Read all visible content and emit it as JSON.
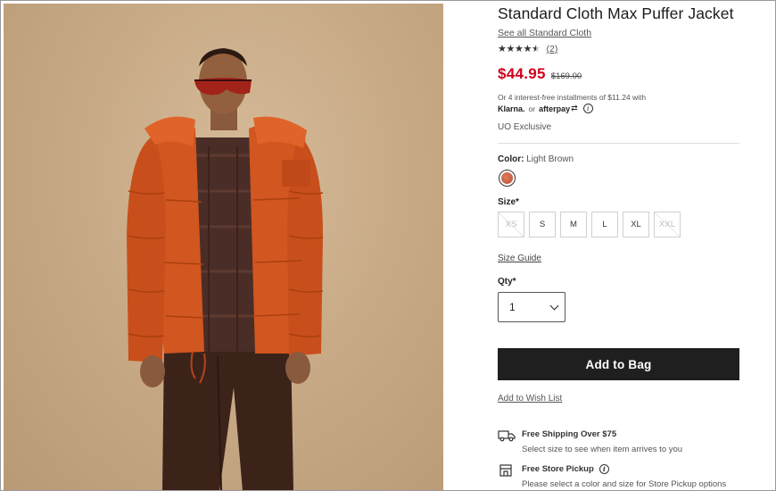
{
  "product": {
    "title": "Standard Cloth Max Puffer Jacket",
    "brand_link": "See all Standard Cloth",
    "rating": 4.5,
    "review_count": "(2)",
    "sale_price": "$44.95",
    "original_price": "$169.00",
    "installments_text": "Or 4 interest-free installments of $11.24 with",
    "klarna_label": "Klarna.",
    "or_text": "or",
    "afterpay_label": "afterpay",
    "exclusive": "UO Exclusive"
  },
  "color": {
    "label": "Color:",
    "value": "Light Brown",
    "swatch_color": "#c8623f"
  },
  "size": {
    "label": "Size*",
    "options": [
      {
        "label": "XS",
        "available": false
      },
      {
        "label": "S",
        "available": true
      },
      {
        "label": "M",
        "available": true
      },
      {
        "label": "L",
        "available": true
      },
      {
        "label": "XL",
        "available": true
      },
      {
        "label": "XXL",
        "available": false
      }
    ],
    "guide_link": "Size Guide"
  },
  "quantity": {
    "label": "Qty*",
    "value": "1"
  },
  "actions": {
    "add_to_bag": "Add to Bag",
    "wish_list": "Add to Wish List"
  },
  "fulfillment": {
    "shipping_title": "Free Shipping Over $75",
    "shipping_sub": "Select size to see when item arrives to you",
    "pickup_title": "Free Store Pickup",
    "pickup_sub": "Please select a color and size for Store Pickup options"
  },
  "icons": {
    "star": "star-icon",
    "info": "info-icon",
    "truck": "truck-icon",
    "store": "store-icon",
    "chevron": "chevron-down-icon"
  },
  "colors": {
    "sale_price": "#d0021b",
    "button_bg": "#1f1f1f",
    "jacket": "#d2561f"
  }
}
